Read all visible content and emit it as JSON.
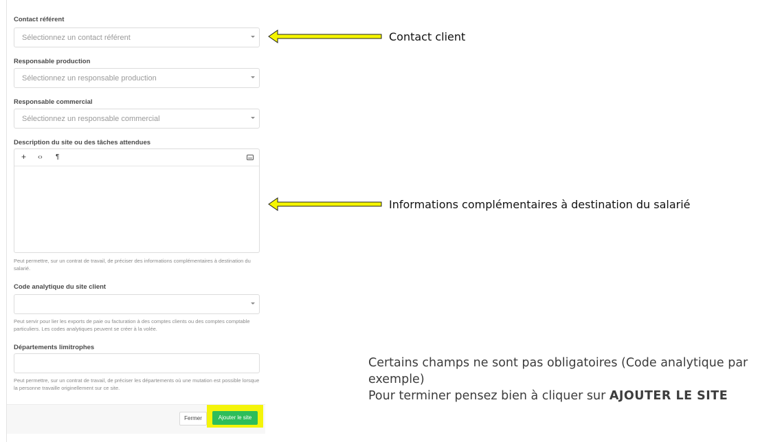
{
  "form": {
    "contact_referent": {
      "label": "Contact référent",
      "placeholder": "Sélectionnez un contact référent"
    },
    "responsable_production": {
      "label": "Responsable production",
      "placeholder": "Sélectionnez un responsable production"
    },
    "responsable_commercial": {
      "label": "Responsable commercial",
      "placeholder": "Sélectionnez un responsable commercial"
    },
    "description": {
      "label": "Description du site ou des tâches attendues",
      "toolbar": {
        "add": "+",
        "code": "‹›",
        "paragraph": "¶"
      },
      "help": "Peut permettre, sur un contrat de travail, de préciser des informations complémentaires à destination du salarié."
    },
    "code_analytique": {
      "label": "Code analytique du site client",
      "help": "Peut servir pour lier les exports de paie ou facturation à des comptes clients ou des comptes comptable particuliers. Les codes analytiques peuvent se créer à la volée."
    },
    "departements": {
      "label": "Départements limitrophes",
      "help": "Peut permettre, sur un contrat de travail, de préciser les départements où une mutation est possible lorsque la personne travaille originellement sur ce site."
    },
    "footer": {
      "close_label": "Fermer",
      "add_label": "Ajouter le site"
    }
  },
  "annotations": {
    "contact_client": "Contact client",
    "informations": "Informations complémentaires à destination du salarié",
    "note_line1": "Certains champs ne sont pas obligatoires (Code analytique par exemple)",
    "note_line2": "Pour terminer pensez bien à cliquer sur ",
    "note_bold": "AJOUTER LE SITE"
  },
  "colors": {
    "arrow_fill": "#f5f500",
    "highlight": "#f4f40a",
    "primary_button": "#2dbd5a"
  }
}
